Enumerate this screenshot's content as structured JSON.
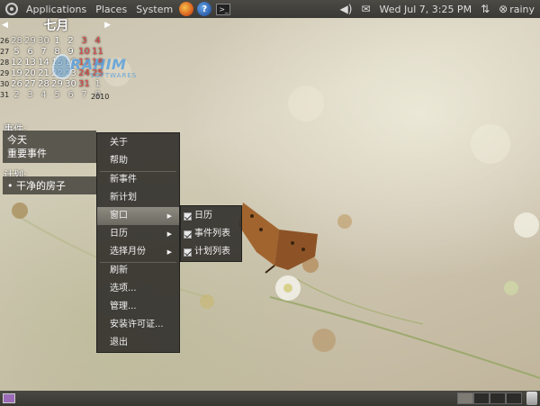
{
  "top_panel": {
    "menus": [
      "Applications",
      "Places",
      "System"
    ],
    "launchers": [
      "firefox-icon",
      "help-icon",
      "terminal-icon"
    ],
    "help_glyph": "?",
    "terminal_glyph": ">_",
    "volume_glyph": "◀)",
    "mail_glyph": "✉",
    "datetime": "Wed Jul  7,  3:25 PM",
    "network_glyph": "⇅",
    "session_glyph": "⊗",
    "user": "rainy"
  },
  "calendar": {
    "prev": "◀",
    "next": "▶",
    "month": "七月",
    "year": "2010",
    "weeks": [
      {
        "week": "26",
        "days": [
          "28",
          "29",
          "30",
          "1",
          "2",
          "3",
          "4"
        ],
        "red": [
          5,
          6
        ],
        "dim": [
          0,
          1,
          2
        ]
      },
      {
        "week": "27",
        "days": [
          "5",
          "6",
          "7",
          "8",
          "9",
          "10",
          "11"
        ],
        "red": [
          5,
          6
        ],
        "dim": []
      },
      {
        "week": "28",
        "days": [
          "12",
          "13",
          "14",
          "15",
          "16",
          "17",
          "18"
        ],
        "red": [
          5,
          6
        ],
        "dim": []
      },
      {
        "week": "29",
        "days": [
          "19",
          "20",
          "21",
          "22",
          "23",
          "24",
          "25"
        ],
        "red": [
          5,
          6
        ],
        "dim": []
      },
      {
        "week": "30",
        "days": [
          "26",
          "27",
          "28",
          "29",
          "30",
          "31",
          "1"
        ],
        "red": [
          5
        ],
        "dim": [
          6
        ]
      },
      {
        "week": "31",
        "days": [
          "2",
          "3",
          "4",
          "5",
          "6",
          "7",
          "8"
        ],
        "red": [
          5,
          6
        ],
        "dim": [
          0,
          1,
          2,
          3,
          4,
          5,
          6
        ]
      }
    ]
  },
  "watermark": {
    "text": "RAHIM",
    "sub": "SOFTWARES"
  },
  "events": {
    "label": "事件:",
    "items": [
      "今天",
      "重要事件"
    ]
  },
  "plans": {
    "label": "计划:",
    "items": [
      "• 干净的房子"
    ]
  },
  "context_menu": {
    "items": [
      {
        "label": "关于"
      },
      {
        "label": "帮助"
      },
      {
        "label": "新事件"
      },
      {
        "label": "新计划"
      },
      {
        "label": "窗口",
        "submenu": true,
        "active": true
      },
      {
        "label": "日历",
        "submenu": true
      },
      {
        "label": "选择月份",
        "submenu": true
      },
      {
        "label": "刷新"
      },
      {
        "label": "选项..."
      },
      {
        "label": "管理..."
      },
      {
        "label": "安装许可证..."
      },
      {
        "label": "退出"
      }
    ],
    "submenu_arrow": "▶"
  },
  "window_submenu": {
    "items": [
      {
        "label": "日历",
        "checked": true
      },
      {
        "label": "事件列表",
        "checked": true
      },
      {
        "label": "计划列表",
        "checked": true
      }
    ]
  }
}
